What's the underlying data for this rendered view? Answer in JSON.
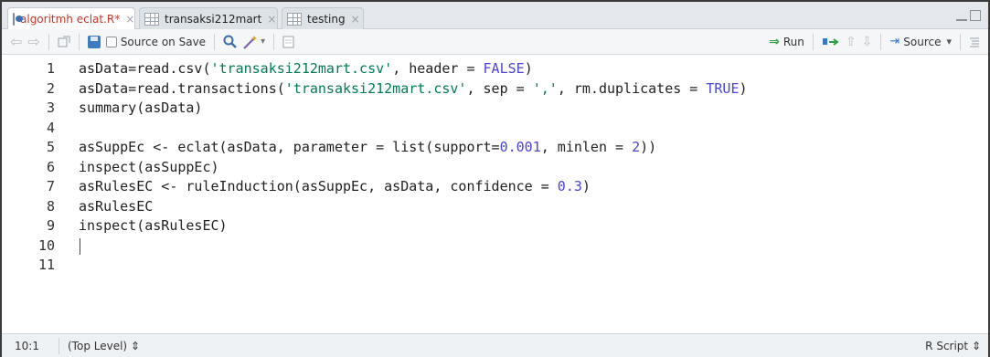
{
  "tabs": [
    {
      "label": "algoritmh eclat.R*",
      "close": "×",
      "icon": "r-file-icon",
      "active": true
    },
    {
      "label": "transaksi212mart",
      "close": "×",
      "icon": "data-grid-icon",
      "active": false
    },
    {
      "label": "testing",
      "close": "×",
      "icon": "data-grid-icon",
      "active": false
    }
  ],
  "toolbar": {
    "source_on_save": "Source on Save",
    "run": "Run",
    "source": "Source",
    "dropdown_caret": "▾",
    "icons": [
      "back-arrow-icon",
      "forward-arrow-icon",
      "show-in-window-icon",
      "save-icon",
      "search-icon",
      "magic-wand-icon",
      "compile-report-icon",
      "run-icon",
      "rerun-icon",
      "up-arrow-icon",
      "down-arrow-icon",
      "source-icon",
      "outline-icon"
    ]
  },
  "editor": {
    "lines": [
      {
        "n": "1",
        "parts": [
          {
            "t": "asData=read.csv(",
            "c": "plain"
          },
          {
            "t": "'transaksi212mart.csv'",
            "c": "str"
          },
          {
            "t": ", header = ",
            "c": "plain"
          },
          {
            "t": "FALSE",
            "c": "const"
          },
          {
            "t": ")",
            "c": "plain"
          }
        ]
      },
      {
        "n": "2",
        "parts": [
          {
            "t": "asData=read.transactions(",
            "c": "plain"
          },
          {
            "t": "'transaksi212mart.csv'",
            "c": "str"
          },
          {
            "t": ", sep = ",
            "c": "plain"
          },
          {
            "t": "','",
            "c": "str"
          },
          {
            "t": ", rm.duplicates = ",
            "c": "plain"
          },
          {
            "t": "TRUE",
            "c": "const"
          },
          {
            "t": ")",
            "c": "plain"
          }
        ]
      },
      {
        "n": "3",
        "parts": [
          {
            "t": "summary(asData)",
            "c": "plain"
          }
        ]
      },
      {
        "n": "4",
        "parts": []
      },
      {
        "n": "5",
        "parts": [
          {
            "t": "asSuppEc <- eclat(asData, parameter = list(support=",
            "c": "plain"
          },
          {
            "t": "0.001",
            "c": "const"
          },
          {
            "t": ", minlen = ",
            "c": "plain"
          },
          {
            "t": "2",
            "c": "const"
          },
          {
            "t": "))",
            "c": "plain"
          }
        ]
      },
      {
        "n": "6",
        "parts": [
          {
            "t": "inspect(asSuppEc)",
            "c": "plain"
          }
        ]
      },
      {
        "n": "7",
        "parts": [
          {
            "t": "asRulesEC <- ruleInduction(asSuppEc, asData, confidence = ",
            "c": "plain"
          },
          {
            "t": "0.3",
            "c": "const"
          },
          {
            "t": ")",
            "c": "plain"
          }
        ]
      },
      {
        "n": "8",
        "parts": [
          {
            "t": "asRulesEC",
            "c": "plain"
          }
        ]
      },
      {
        "n": "9",
        "parts": [
          {
            "t": "inspect(asRulesEC)",
            "c": "plain"
          }
        ]
      },
      {
        "n": "10",
        "parts": []
      },
      {
        "n": "11",
        "parts": []
      }
    ],
    "cursor_line": 10
  },
  "status": {
    "position": "10:1",
    "scope": "(Top Level) ⇕",
    "language": "R Script ⇕"
  },
  "colors": {
    "string": "#037a52",
    "constant": "#4b44d8"
  }
}
